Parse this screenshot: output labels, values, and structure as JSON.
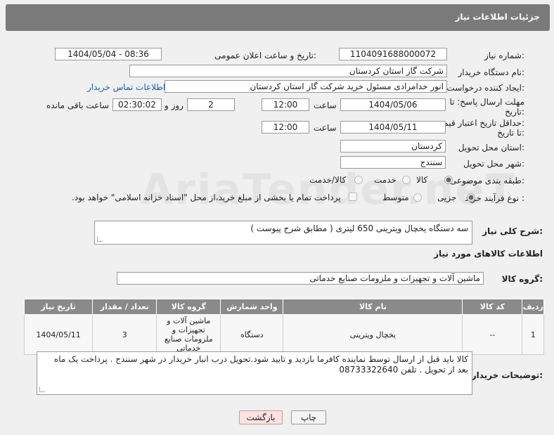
{
  "header": {
    "title": "جزئیات اطلاعات نیاز"
  },
  "form": {
    "need_number_label": "شماره نیاز:",
    "need_number": "1104091688000072",
    "announce_label": "تاریخ و ساعت اعلان عمومی:",
    "announce_value": "1404/05/04 - 08:36",
    "buyer_label": "نام دستگاه خریدار:",
    "buyer_value": "شرکت گاز استان کردستان",
    "creator_label": "ایجاد کننده درخواست:",
    "creator_value": "انور خدامرادی مسئول خرید  شرکت گاز استان کردستان",
    "contact_link": "اطلاعات تماس خریدار",
    "deadline_label_1": "مهلت ارسال پاسخ: تا",
    "deadline_label_2": "تاریخ:",
    "deadline_date": "1404/05/06",
    "time_label": "ساعت",
    "deadline_time": "12:00",
    "days_value": "2",
    "days_label": "روز و",
    "remaining_time": "02:30:02",
    "remaining_label": "ساعت باقی مانده",
    "price_label_1": "حداقل تاریخ اعتبار قیمت:",
    "price_label_2": "تا تاریخ:",
    "price_date": "1404/05/11",
    "price_time": "12:00",
    "province_label": "استان محل تحویل:",
    "province_value": "کردستان",
    "city_label": "شهر محل تحویل:",
    "city_value": "سنندج",
    "category_label": "طبقه بندی موضوعی:",
    "category_options": [
      "کالا",
      "خدمت",
      "کالا/خدمت"
    ],
    "process_label": "نوع فرآیند خرید :",
    "process_options": [
      "جزیی",
      "متوسط"
    ],
    "process_note": "پرداخت تمام یا بخشی از مبلغ خرید،از محل \"اسناد خزانه اسلامی\" خواهد بود."
  },
  "description": {
    "label": "شرح کلی نیاز:",
    "value": "سه دستگاه یخچال ویترینی 650 لیتری ( مطابق شرح پیوست )"
  },
  "goods": {
    "section_title": "اطلاعات کالاهای مورد نیاز",
    "group_label": "گروه کالا:",
    "group_value": "ماشین آلات و تجهیزات و ملزومات صنایع خدماتی",
    "columns": [
      "ردیف",
      "کد کالا",
      "نام کالا",
      "واحد شمارش",
      "گروه کالا",
      "تعداد / مقدار",
      "تاریخ نیاز"
    ],
    "rows": [
      [
        "1",
        "--",
        "یخچال ویترینی",
        "دستگاه",
        "ماشین آلات و تجهیزات و ملزومات صنایع خدماتی",
        "3",
        "1404/05/11"
      ]
    ]
  },
  "buyer_notes": {
    "label": "توضیحات خریدار:",
    "value": "کالا باید قبل از ارسال توسط نماینده کافرما بازدید و تایید شود.تحویل درب انبار خریدار در شهر سنندج  . پرداخت یک ماه بعد از تحویل . تلفن 08733322640"
  },
  "buttons": {
    "print": "چاپ",
    "back": "بازگشت"
  },
  "watermark": "AriaTender.neT"
}
